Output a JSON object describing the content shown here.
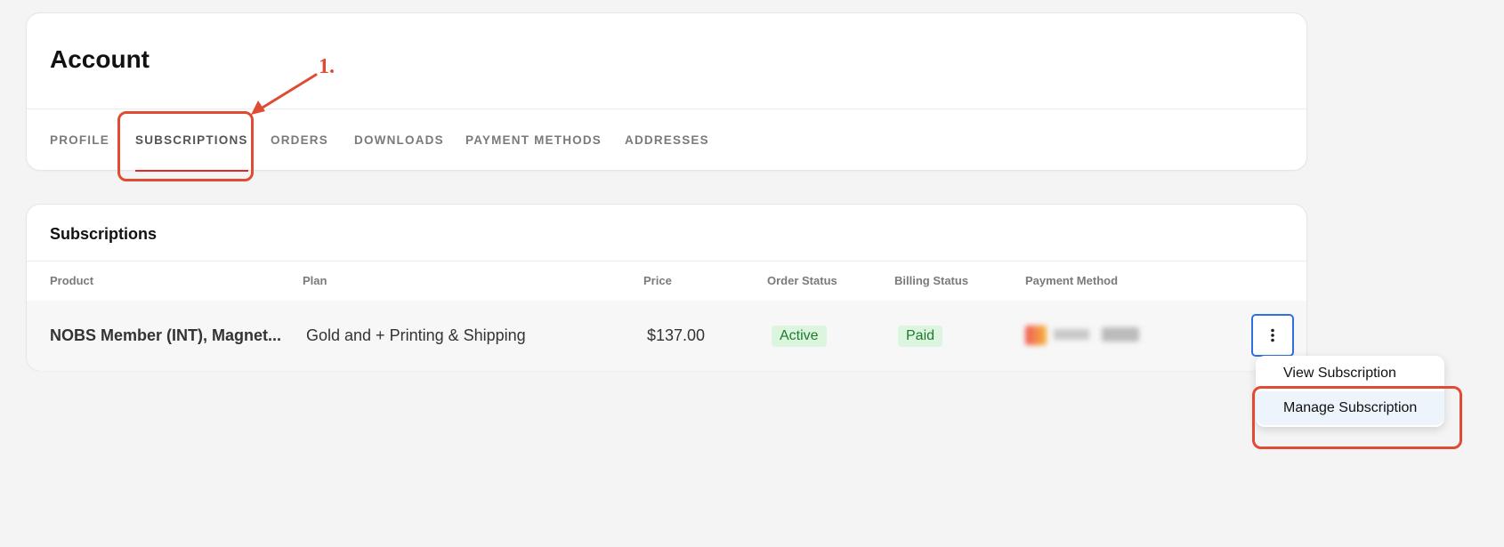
{
  "account": {
    "title": "Account",
    "tabs": [
      {
        "label": "PROFILE"
      },
      {
        "label": "SUBSCRIPTIONS",
        "active": true
      },
      {
        "label": "ORDERS"
      },
      {
        "label": "DOWNLOADS"
      },
      {
        "label": "PAYMENT METHODS"
      },
      {
        "label": "ADDRESSES"
      }
    ]
  },
  "subscriptions": {
    "title": "Subscriptions",
    "columns": [
      "Product",
      "Plan",
      "Price",
      "Order Status",
      "Billing Status",
      "Payment Method"
    ],
    "rows": [
      {
        "product": "NOBS Member (INT), Magnet...",
        "plan": "Gold and + Printing & Shipping",
        "price": "$137.00",
        "order_status": "Active",
        "billing_status": "Paid",
        "payment_method_icon": "credit-card-icon"
      }
    ]
  },
  "actions_menu": {
    "items": [
      "View Subscription",
      "Manage Subscription"
    ]
  },
  "annotation": {
    "step_label": "1.",
    "color": "#e04b33"
  },
  "colors": {
    "tab_underline": "#e0262c",
    "focus_border": "#2f6fe0",
    "badge_bg": "#dcf5de",
    "badge_text": "#1e7a2e",
    "menu_highlight": "#eef4fc"
  }
}
